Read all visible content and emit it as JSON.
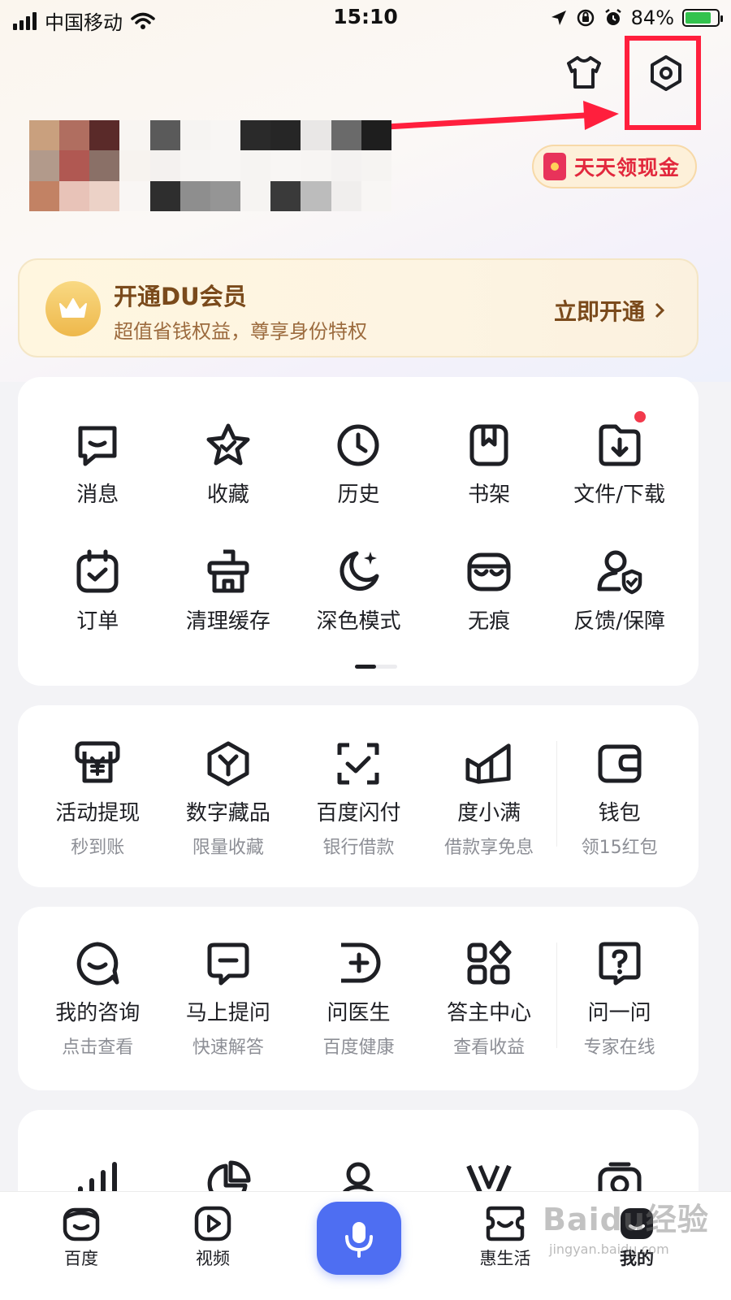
{
  "status_bar": {
    "carrier": "中国移动",
    "time": "15:10",
    "battery": "84%",
    "battery_level": 0.84
  },
  "header": {
    "icons": [
      "shirt-icon",
      "settings-icon"
    ],
    "highlight_color": "#ff1f3d"
  },
  "cash_pill": {
    "label": "天天领现金"
  },
  "vip_banner": {
    "title": "开通DU会员",
    "subtitle": "超值省钱权益，尊享身份特权",
    "cta": "立即开通"
  },
  "quick_tools": {
    "row1": [
      "消息",
      "收藏",
      "历史",
      "书架",
      "文件/下载"
    ],
    "row2": [
      "订单",
      "清理缓存",
      "深色模式",
      "无痕",
      "反馈/保障"
    ]
  },
  "finance": [
    {
      "label": "活动提现",
      "sub": "秒到账"
    },
    {
      "label": "数字藏品",
      "sub": "限量收藏"
    },
    {
      "label": "百度闪付",
      "sub": "银行借款"
    },
    {
      "label": "度小满",
      "sub": "借款享免息"
    },
    {
      "label": "钱包",
      "sub": "领15红包"
    }
  ],
  "health": [
    {
      "label": "我的咨询",
      "sub": "点击查看"
    },
    {
      "label": "马上提问",
      "sub": "快速解答"
    },
    {
      "label": "问医生",
      "sub": "百度健康"
    },
    {
      "label": "答主中心",
      "sub": "查看收益"
    },
    {
      "label": "问一问",
      "sub": "专家在线"
    }
  ],
  "tabbar": {
    "home": "百度",
    "video": "视频",
    "life": "惠生活",
    "mine": "我的",
    "accent": "#4e6ef2"
  },
  "watermark": {
    "brand": "Baidu经验",
    "url": "jingyan.baidu.com"
  }
}
